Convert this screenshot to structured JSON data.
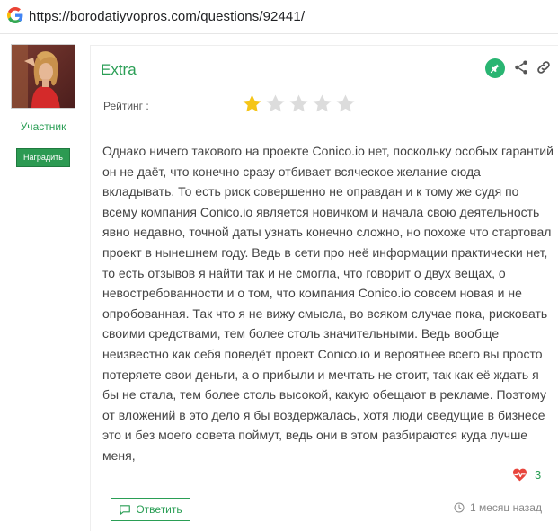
{
  "browser": {
    "url": "https://borodatiyvopros.com/questions/92441/",
    "search_engine_icon": "google-g-icon"
  },
  "user": {
    "role": "Участник",
    "award_label": "Наградить",
    "avatar": "user-avatar-photo"
  },
  "post": {
    "author": "Extra",
    "rating_label": "Рейтинг :",
    "rating": {
      "value": 1,
      "max": 5
    },
    "text": "Однако ничего такового на проекте Conico.io нет, поскольку особых гарантий он не даёт, что конечно сразу отбивает всяческое желание сюда вкладывать. То есть риск совершенно не оправдан и к тому же судя по всему компания Conico.io является новичком и начала свою деятельность явно недавно, точной даты узнать конечно сложно, но похоже что стартовал проект в нынешнем году. Ведь в сети про неё информации практически нет, то есть отзывов я найти так и не смогла, что говорит о двух вещах, о невостребованности и о том, что компания Conico.io совсем новая и не опробованная. Так что я не вижу смысла, во всяком случае пока, рисковать своими средствами, тем более столь значительными. Ведь вообще неизвестно как себя поведёт проект Conico.io и вероятнее всего вы просто потеряете свои деньги, а о прибыли и мечтать не стоит, так как её ждать я бы не стала, тем более столь высокой, какую обещают в рекламе. Поэтому от вложений в это дело я бы воздержалась, хотя люди сведущие в бизнесе это и без моего совета поймут, ведь они в этом разбираются куда лучше меня,",
    "likes": "3",
    "reply_label": "Ответить",
    "time": "1 месяц назад"
  },
  "icons": {
    "pin": "pin-icon",
    "share": "share-icon",
    "link": "link-icon",
    "heart": "heart-pulse-icon",
    "reply": "comment-icon",
    "clock": "clock-icon",
    "star_filled": "star-filled-icon",
    "star_empty": "star-empty-icon"
  },
  "colors": {
    "accent": "#2a9e55",
    "pin_bg": "#29b572",
    "star_filled": "#f5c518",
    "star_empty": "#dcdcdc",
    "heart": "#e8453c"
  }
}
